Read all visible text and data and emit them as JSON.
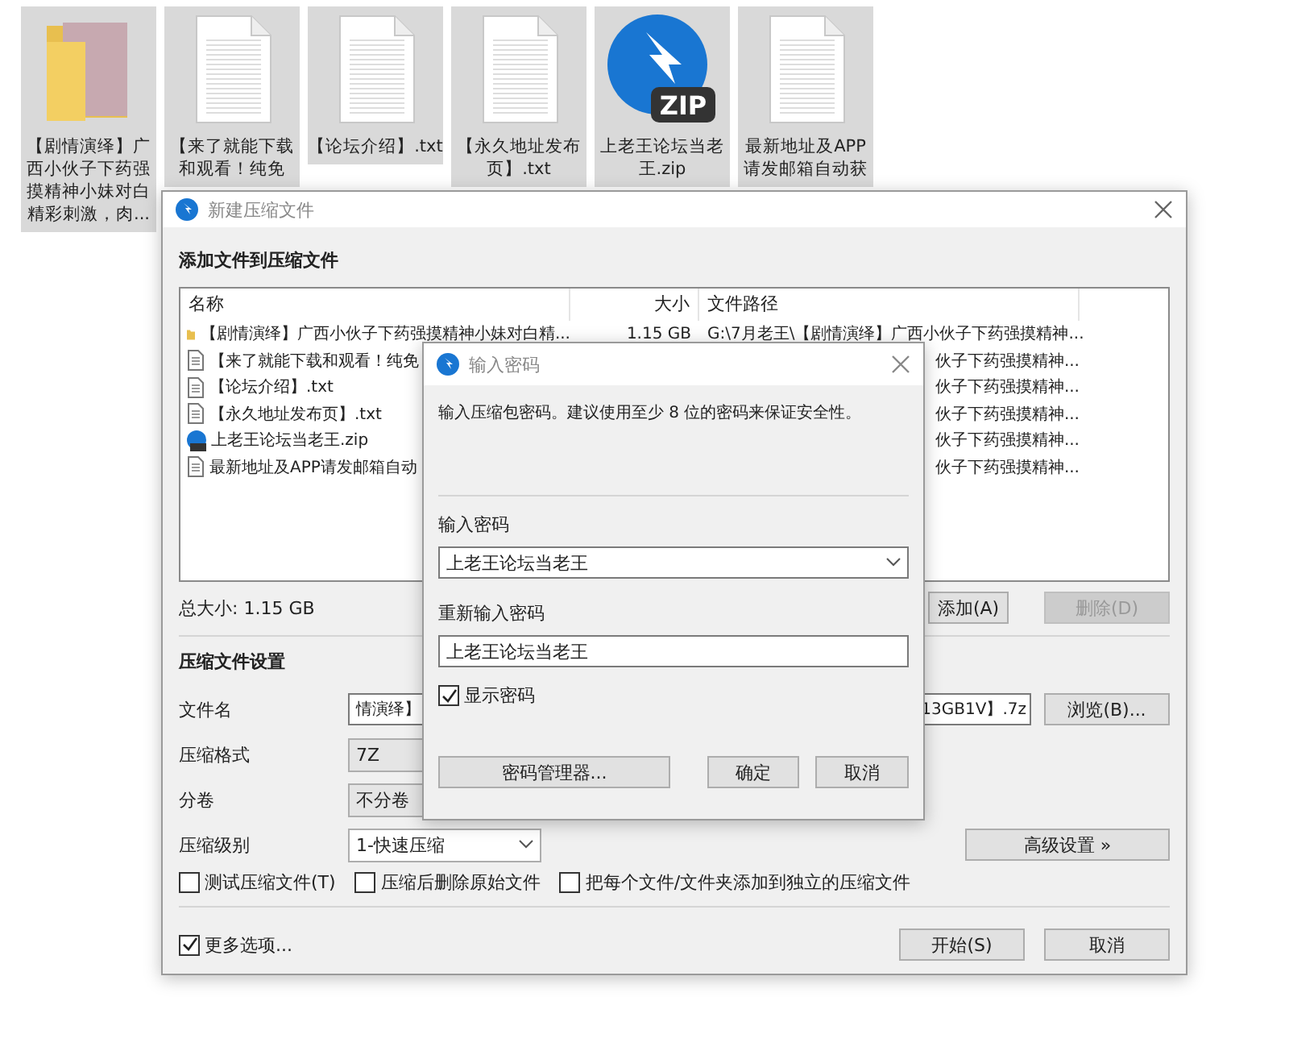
{
  "desktop_icons": [
    {
      "label": "【剧情演绎】广西小伙子下药强摸精神小妹对白精彩刺激，肉...",
      "kind": "photo-folder",
      "selected": true
    },
    {
      "label": "【来了就能下载和观看！纯免",
      "kind": "text",
      "selected": true
    },
    {
      "label": "【论坛介绍】.txt",
      "kind": "text",
      "selected": true
    },
    {
      "label": "【永久地址发布页】.txt",
      "kind": "text",
      "selected": true
    },
    {
      "label": "上老王论坛当老王.zip",
      "kind": "zip",
      "badge": "ZIP",
      "selected": true
    },
    {
      "label": "最新地址及APP请发邮箱自动获",
      "kind": "text",
      "selected": true
    }
  ],
  "archive_window": {
    "title": "新建压缩文件",
    "section_title": "添加文件到压缩文件",
    "columns": [
      "名称",
      "大小",
      "文件路径"
    ],
    "rows": [
      {
        "kind": "folder",
        "name": "【剧情演绎】广西小伙子下药强摸精神小妹对白精...",
        "size": "1.15 GB",
        "path": "G:\\7月老王\\【剧情演绎】广西小伙子下药强摸精神..."
      },
      {
        "kind": "text",
        "name": "【来了就能下载和观看！纯免",
        "path": "伙子下药强摸精神..."
      },
      {
        "kind": "text",
        "name": "【论坛介绍】.txt",
        "path": "伙子下药强摸精神..."
      },
      {
        "kind": "text",
        "name": "【永久地址发布页】.txt",
        "path": "伙子下药强摸精神..."
      },
      {
        "kind": "zip",
        "name": "上老王论坛当老王.zip",
        "path": "伙子下药强摸精神..."
      },
      {
        "kind": "text",
        "name": "最新地址及APP请发邮箱自动",
        "path": "伙子下药强摸精神..."
      }
    ],
    "total_size": "总大小: 1.15 GB",
    "add_button": {
      "label": "添加(A)",
      "disabled": false
    },
    "delete_button": {
      "label": "删除(D)",
      "disabled": true
    },
    "settings_title": "压缩文件设置",
    "filename": {
      "label": "文件名",
      "value_start": "情演绎】",
      "value_end": "13GB1V】.7z",
      "browse_button": "浏览(B)..."
    },
    "format": {
      "label": "压缩格式",
      "value": "7Z"
    },
    "volume": {
      "label": "分卷",
      "value": "不分卷"
    },
    "level": {
      "label": "压缩级别",
      "value": "1-快速压缩"
    },
    "advanced_button": "高级设置 »",
    "options": [
      {
        "label": "测试压缩文件(T)",
        "checked": false
      },
      {
        "label": "压缩后删除原始文件",
        "checked": false
      },
      {
        "label": "把每个文件/文件夹添加到独立的压缩文件",
        "checked": false
      }
    ],
    "more_options": {
      "label": "更多选项...",
      "checked": true
    },
    "start_button": "开始(S)",
    "cancel_button": "取消"
  },
  "password_dialog": {
    "title": "输入密码",
    "message": "输入压缩包密码。建议使用至少 8 位的密码来保证安全性。",
    "password_label": "输入密码",
    "password": "上老王论坛当老王",
    "repeat_label": "重新输入密码",
    "repeat_password": "上老王论坛当老王",
    "show_password": {
      "label": "显示密码",
      "checked": true
    },
    "buttons": [
      "密码管理器...",
      "确定",
      "取消"
    ]
  }
}
